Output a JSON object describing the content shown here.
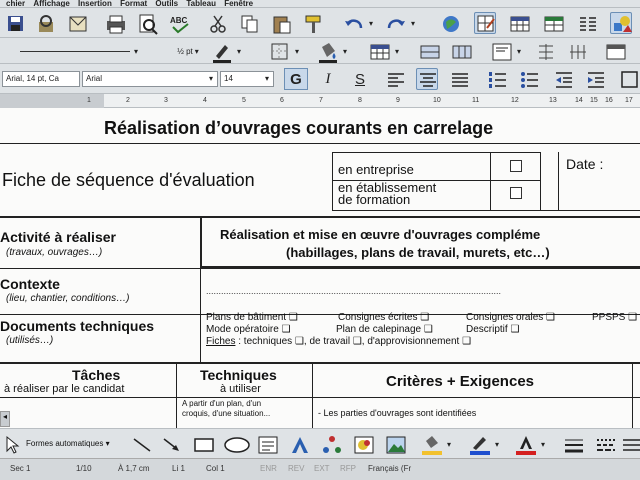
{
  "menubar": {
    "items": [
      "chier",
      "Affichage",
      "Insertion",
      "Format",
      "Outils",
      "Tableau",
      "Fenêtre"
    ]
  },
  "formatting": {
    "style_value": "Arial, 14 pt, Ca",
    "font_value": "Arial",
    "size_value": "14",
    "line_weight": "½ pt",
    "bold_label": "G",
    "italic_label": "I",
    "strike_label": "S",
    "spell_label": "ABC"
  },
  "ruler": {
    "numbers": [
      "1",
      "2",
      "3",
      "4",
      "5",
      "6",
      "7",
      "8",
      "9",
      "10",
      "11",
      "12",
      "13",
      "14",
      "15",
      "16",
      "17"
    ]
  },
  "doc": {
    "title": "Réalisation d’ouvrages courants en carrelage",
    "fiche": "Fiche de séquence d'évaluation",
    "entreprise": "en entreprise",
    "etab1": "en établissement",
    "etab2": "de formation",
    "date_label": "Date :",
    "activite_title": "Activité à réaliser",
    "activite_sub": "(travaux, ouvrages…)",
    "activite_value1": "Réalisation et mise en œuvre d'ouvrages compléme",
    "activite_value2": "(habillages, plans de travail, murets, etc…)",
    "contexte_title": "Contexte",
    "contexte_sub": "(lieu, chantier, conditions…)",
    "dots": "......................................................................................................................",
    "docs_title": "Documents techniques",
    "docs_sub": "(utilisés…)",
    "docs_row1": [
      "Plans de bâtiment ❑",
      "Consignes écrites ❑",
      "Consignes orales ❑",
      "PPSPS ❑"
    ],
    "docs_row2": [
      "Mode opératoire ❑",
      "Plan de calepinage ❑",
      "Descriptif ❑"
    ],
    "docs_fiches_label": "Fiches",
    "docs_fiches_rest": ": techniques ❑, de travail ❑, d'approvisionnement ❑",
    "taches_title": "Tâches",
    "taches_sub": "à réaliser par le candidat",
    "techniques_title": "Techniques",
    "techniques_sub": "à utiliser",
    "criteres_title": "Critères + Exigences",
    "tech_cell1": "A partir d'un plan, d'un",
    "tech_cell2": "croquis, d'une situation...",
    "crit_cell": "- Les parties d'ouvrages sont identifiées"
  },
  "drawing": {
    "autoshapes_label": "Formes automatiques ▾"
  },
  "status": {
    "sec": "Sec 1",
    "page": "1/10",
    "pos": "À 1,7 cm",
    "li": "Li 1",
    "col": "Col 1",
    "enr": "ENR",
    "rev": "REV",
    "ext": "EXT",
    "rfp": "RFP",
    "lang": "Français (Fr"
  },
  "colors": {
    "fill": "#f2c12e",
    "line": "#1f4fcf",
    "font": "#d42020"
  }
}
